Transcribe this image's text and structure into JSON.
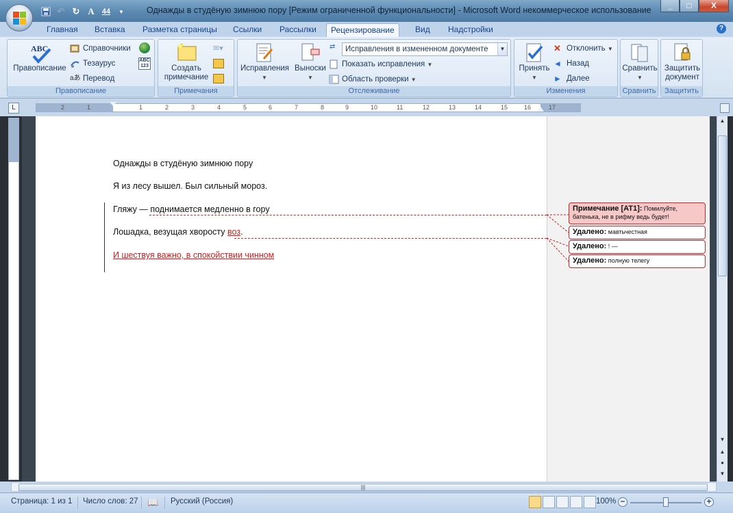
{
  "window": {
    "title": "Однажды в студёную зимнюю пору [Режим ограниченной функциональности] - Microsoft Word некоммерческое использование",
    "min": "_",
    "max": "□",
    "close": "X"
  },
  "tabs": [
    "Главная",
    "Вставка",
    "Разметка страницы",
    "Ссылки",
    "Рассылки",
    "Рецензирование",
    "Вид",
    "Надстройки"
  ],
  "active_tab": "Рецензирование",
  "ribbon": {
    "proofing": {
      "label": "Правописание",
      "spelling": "Правописание",
      "research": "Справочники",
      "thesaurus": "Тезаурус",
      "translate": "Перевод",
      "abc_text": "ABC"
    },
    "comments": {
      "label": "Примечания",
      "new_comment": "Создать примечание",
      "new_line1": "Создать",
      "new_line2": "примечание"
    },
    "tracking": {
      "label": "Отслеживание",
      "track_changes": "Исправления",
      "balloons": "Выноски",
      "display_mode": "Исправления в измененном документе",
      "show_markup": "Показать исправления",
      "reviewing_pane": "Область проверки"
    },
    "changes": {
      "label": "Изменения",
      "accept": "Принять",
      "reject": "Отклонить",
      "previous": "Назад",
      "next": "Далее"
    },
    "compare": {
      "label": "Сравнить",
      "compare": "Сравнить"
    },
    "protect": {
      "label": "Защитить",
      "line1": "Защитить",
      "line2": "документ"
    }
  },
  "document": {
    "lines": [
      "Однажды в студёную зимнюю пору",
      "Я из лесу вышел. Был сильный мороз.",
      "Гляжу — поднимается медленно в гору",
      "Лошадка, везущая хворосту",
      "И шествуя важно, в спокойствии чинном"
    ],
    "inserted_word": "воз",
    "line4_end": "."
  },
  "balloons": [
    {
      "kind": "Примечание [AT1]:",
      "text": "Помилуйте, батенька, не в рифму ведь будет!"
    },
    {
      "kind": "Удалено:",
      "text": "мавтьчестная"
    },
    {
      "kind": "Удалено:",
      "text": "! —"
    },
    {
      "kind": "Удалено:",
      "text": "полную телегу"
    }
  ],
  "ruler": {
    "numbers": [
      "2",
      "1",
      "1",
      "2",
      "3",
      "4",
      "5",
      "6",
      "7",
      "8",
      "9",
      "10",
      "11",
      "12",
      "13",
      "14",
      "15",
      "16",
      "17"
    ]
  },
  "status": {
    "page": "Страница: 1 из 1",
    "words": "Число слов: 27",
    "language": "Русский (Россия)",
    "zoom": "100%"
  }
}
